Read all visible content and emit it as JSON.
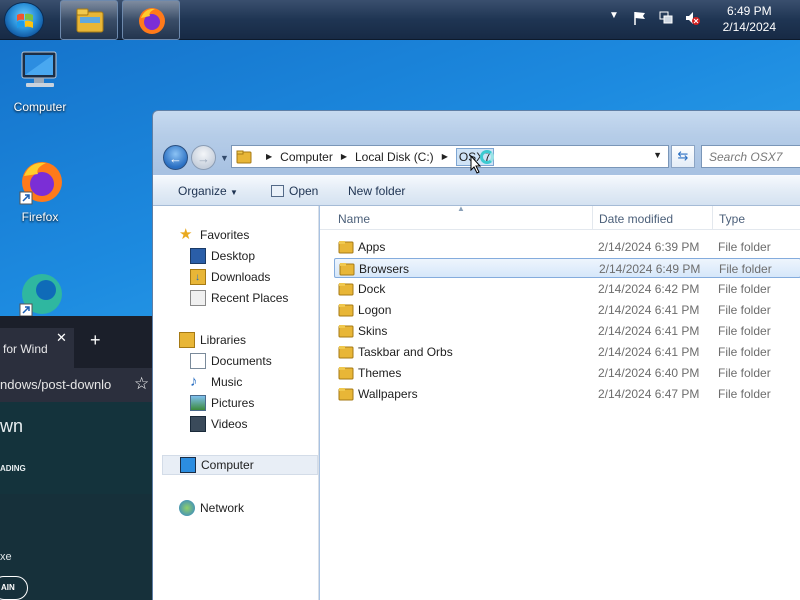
{
  "taskbar": {
    "clock_time": "6:49 PM",
    "clock_date": "2/14/2024",
    "pinned": [
      "windows-explorer",
      "firefox"
    ]
  },
  "desktop": {
    "icons": [
      {
        "label": "Computer"
      },
      {
        "label": "Firefox"
      },
      {
        "label": ""
      }
    ]
  },
  "browser": {
    "tab_title": "for Wind",
    "url_fragment": "ndows/post-downlo",
    "site_logo": "wn",
    "site_nav": "ADING",
    "exe_text": "xe",
    "button_text": "AIN"
  },
  "explorer": {
    "breadcrumbs": [
      "Computer",
      "Local Disk (C:)",
      "OSX7"
    ],
    "search_placeholder": "Search OSX7",
    "toolbar": {
      "organize": "Organize",
      "open": "Open",
      "new_folder": "New folder"
    },
    "nav_pane": {
      "favorites_header": "Favorites",
      "favorites": [
        "Desktop",
        "Downloads",
        "Recent Places"
      ],
      "libraries_header": "Libraries",
      "libraries": [
        "Documents",
        "Music",
        "Pictures",
        "Videos"
      ],
      "computer": "Computer",
      "network": "Network"
    },
    "columns": {
      "name": "Name",
      "date": "Date modified",
      "type": "Type"
    },
    "rows": [
      {
        "name": "Apps",
        "date": "2/14/2024 6:39 PM",
        "type": "File folder"
      },
      {
        "name": "Browsers",
        "date": "2/14/2024 6:49 PM",
        "type": "File folder",
        "selected": true
      },
      {
        "name": "Dock",
        "date": "2/14/2024 6:42 PM",
        "type": "File folder"
      },
      {
        "name": "Logon",
        "date": "2/14/2024 6:41 PM",
        "type": "File folder"
      },
      {
        "name": "Skins",
        "date": "2/14/2024 6:41 PM",
        "type": "File folder"
      },
      {
        "name": "Taskbar and Orbs",
        "date": "2/14/2024 6:41 PM",
        "type": "File folder"
      },
      {
        "name": "Themes",
        "date": "2/14/2024 6:40 PM",
        "type": "File folder"
      },
      {
        "name": "Wallpapers",
        "date": "2/14/2024 6:47 PM",
        "type": "File folder"
      }
    ]
  },
  "colors": {
    "folder": "#e8b637",
    "selection": "#cde3fa",
    "taskbar": "#1f3553"
  }
}
